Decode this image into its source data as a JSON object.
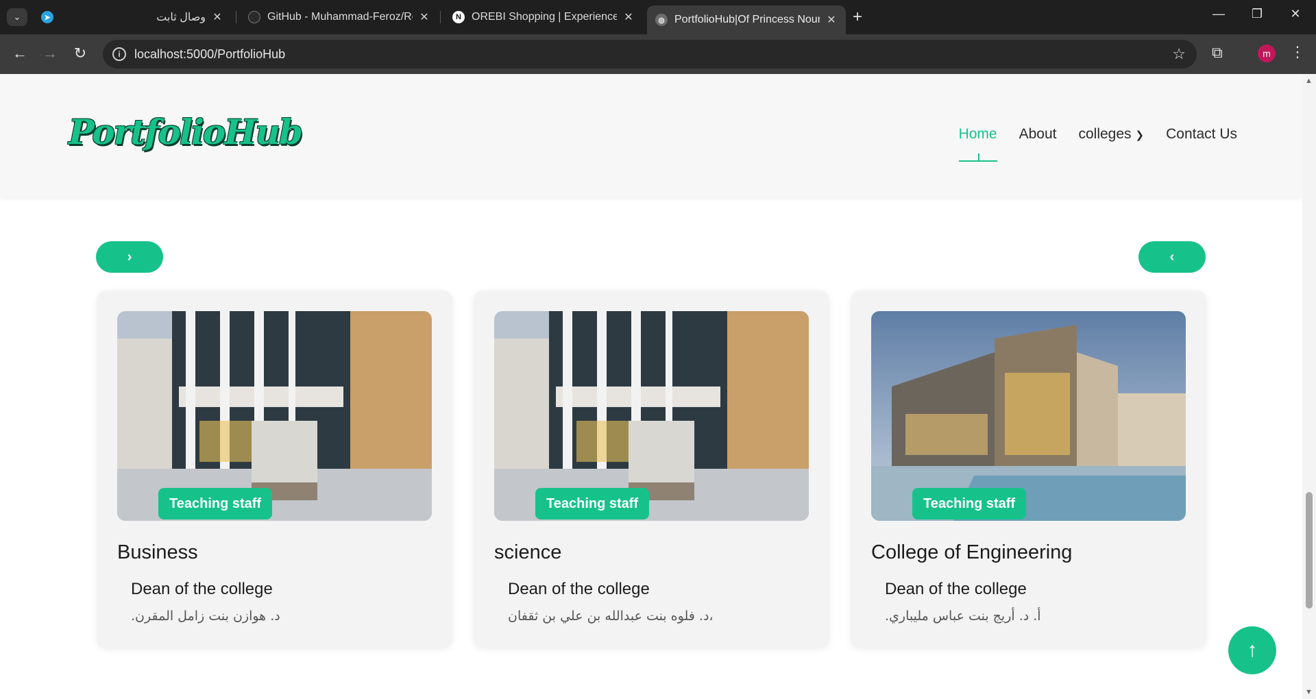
{
  "browser": {
    "tabs": [
      {
        "title": "وصال ثابت",
        "favicon": "telegram-icon"
      },
      {
        "title": "GitHub - Muhammad-Feroz/Re",
        "favicon": "github-icon"
      },
      {
        "title": "OREBI Shopping | Experience th",
        "favicon": "n-logo-icon"
      },
      {
        "title": "PortfolioHub|Of Princess Noura",
        "favicon": "globe-icon"
      }
    ],
    "url": "localhost:5000/PortfolioHub",
    "profile_initial": "m"
  },
  "site": {
    "logo_text": "PortfolioHub",
    "nav": {
      "home": "Home",
      "about": "About",
      "colleges": "colleges",
      "contact": "Contact Us"
    },
    "accent_color": "#17c28a"
  },
  "cards": [
    {
      "badge": "Teaching staff",
      "title": "Business",
      "dean_label": "Dean of the college",
      "dean_name": ".د. هوازن بنت زامل المقرن"
    },
    {
      "badge": "Teaching staff",
      "title": "science",
      "dean_label": "Dean of the college",
      "dean_name": "د. فلوه بنت عبدالله بن علي بن ثقفان،"
    },
    {
      "badge": "Teaching staff",
      "title": "College of Engineering",
      "dean_label": "Dean of the college",
      "dean_name": ".أ. د. أريج بنت عباس مليباري"
    }
  ]
}
